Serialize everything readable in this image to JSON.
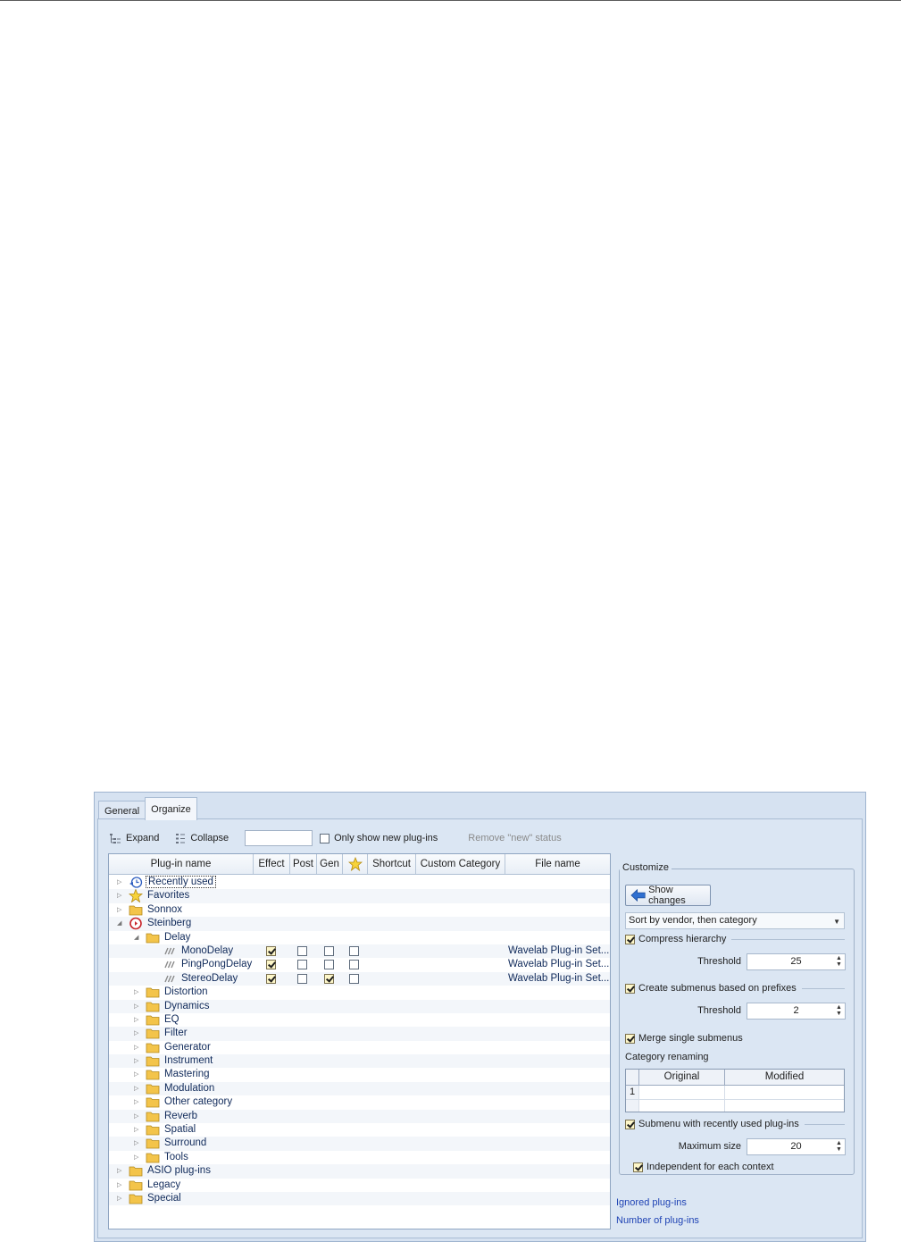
{
  "tabs": [
    {
      "label": "General"
    },
    {
      "label": "Organize"
    }
  ],
  "toolbar": {
    "expand_label": "Expand",
    "collapse_label": "Collapse",
    "search_value": "",
    "only_new_label": "Only show new plug-ins",
    "only_new_checked": false,
    "remove_new_label": "Remove \"new\" status"
  },
  "columns": {
    "name": "Plug-in name",
    "effect": "Effect",
    "post": "Post",
    "gen": "Gen",
    "favorite": "star-icon",
    "shortcut": "Shortcut",
    "custom_category": "Custom Category",
    "file_name": "File name"
  },
  "tree": {
    "recently_used": "Recently used",
    "favorites": "Favorites",
    "sonnox": "Sonnox",
    "steinberg": "Steinberg",
    "delay": "Delay",
    "mono_delay": {
      "name": "MonoDelay",
      "file": "Wavelab Plug-in Set..."
    },
    "pingpong_delay": {
      "name": "PingPongDelay",
      "file": "Wavelab Plug-in Set..."
    },
    "stereo_delay": {
      "name": "StereoDelay",
      "file": "Wavelab Plug-in Set..."
    },
    "categories": [
      "Distortion",
      "Dynamics",
      "EQ",
      "Filter",
      "Generator",
      "Instrument",
      "Mastering",
      "Modulation",
      "Other category",
      "Reverb",
      "Spatial",
      "Surround",
      "Tools"
    ],
    "asio": "ASIO plug-ins",
    "legacy": "Legacy",
    "special": "Special"
  },
  "customize": {
    "title": "Customize",
    "show_changes": "Show changes",
    "sort_value": "Sort by vendor, then category",
    "compress_label": "Compress hierarchy",
    "compress_checked": true,
    "threshold_label": "Threshold",
    "threshold1_value": "25",
    "prefix_label": "Create submenus based on prefixes",
    "prefix_checked": true,
    "threshold2_value": "2",
    "merge_label": "Merge single submenus",
    "merge_checked": true,
    "renaming_label": "Category renaming",
    "original_header": "Original",
    "modified_header": "Modified",
    "row_number": "1",
    "recent_label": "Submenu with recently used plug-ins",
    "recent_checked": true,
    "max_size_label": "Maximum size",
    "max_size_value": "20",
    "independent_label": "Independent for each context",
    "independent_checked": true
  },
  "links": {
    "ignored": "Ignored plug-ins",
    "number": "Number of plug-ins"
  },
  "colors": {
    "dialog_bg": "#d6e2f1",
    "link": "#1f43b4",
    "folder": "#f3c44a"
  }
}
